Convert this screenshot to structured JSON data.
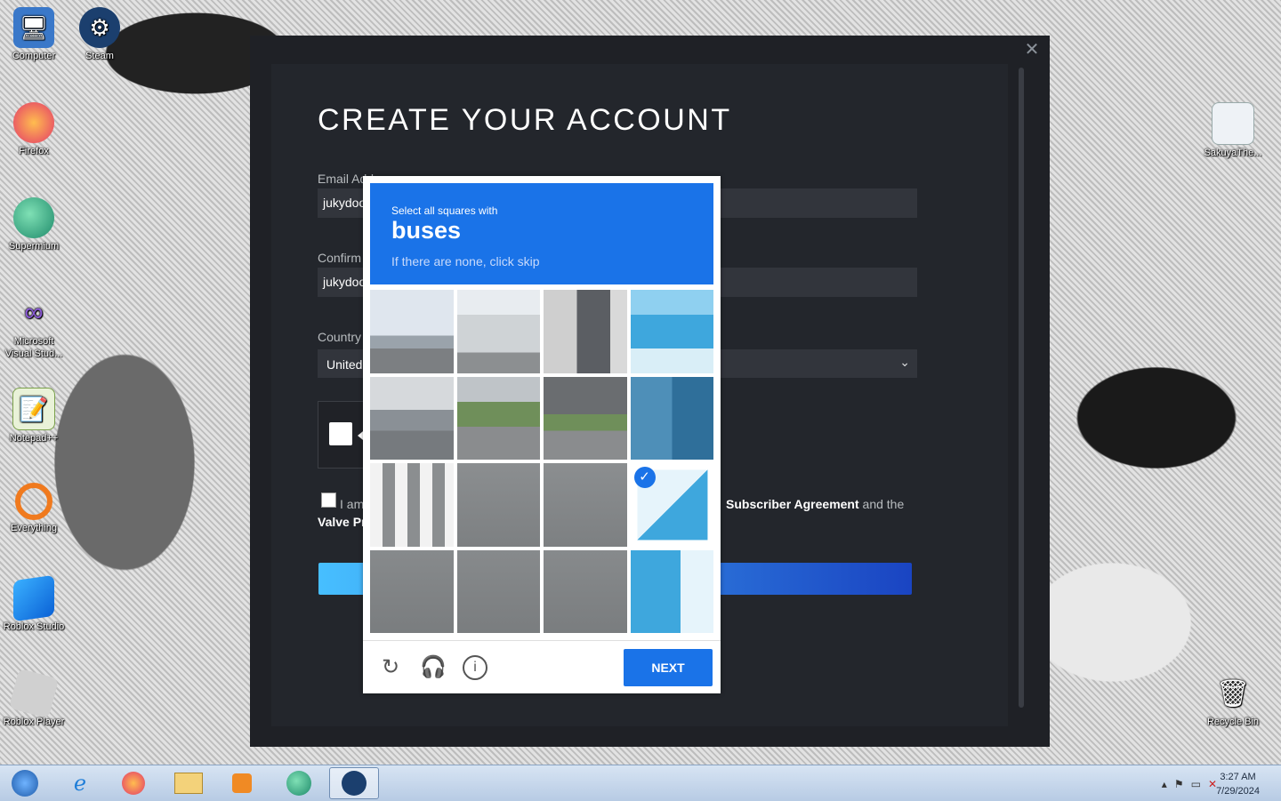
{
  "desktop": {
    "icons": [
      {
        "label": "Computer"
      },
      {
        "label": "Steam"
      },
      {
        "label": "Firefox"
      },
      {
        "label": "Supermium"
      },
      {
        "label": "Microsoft Visual Stud..."
      },
      {
        "label": "Notepad++"
      },
      {
        "label": "Everything"
      },
      {
        "label": "Roblox Studio"
      },
      {
        "label": "Roblox Player"
      },
      {
        "label": "SakuyaThe..."
      },
      {
        "label": "Recycle Bin"
      }
    ]
  },
  "steam": {
    "title": "CREATE YOUR ACCOUNT",
    "close_glyph": "✕",
    "email_label": "Email Add",
    "email_value": "jukydoo",
    "confirm_label": "Confirm",
    "confirm_value": "jukydoo",
    "country_label": "Country",
    "country_value": "United",
    "agree_text": "I am",
    "agree_right_bold": "Subscriber Agreement",
    "agree_right_rest": " and the",
    "valve_line": "Valve Pr"
  },
  "captcha": {
    "instruction": "Select all squares with",
    "target": "buses",
    "hint": "If there are none, click skip",
    "next_label": "NEXT",
    "selected_tiles": [
      11
    ],
    "tools": [
      "refresh-icon",
      "audio-icon",
      "info-icon"
    ]
  },
  "taskbar": {
    "time": "3:27 AM",
    "date": "7/29/2024"
  },
  "colors": {
    "captcha_blue": "#1a73e8",
    "steam_bg": "#1f2126"
  }
}
